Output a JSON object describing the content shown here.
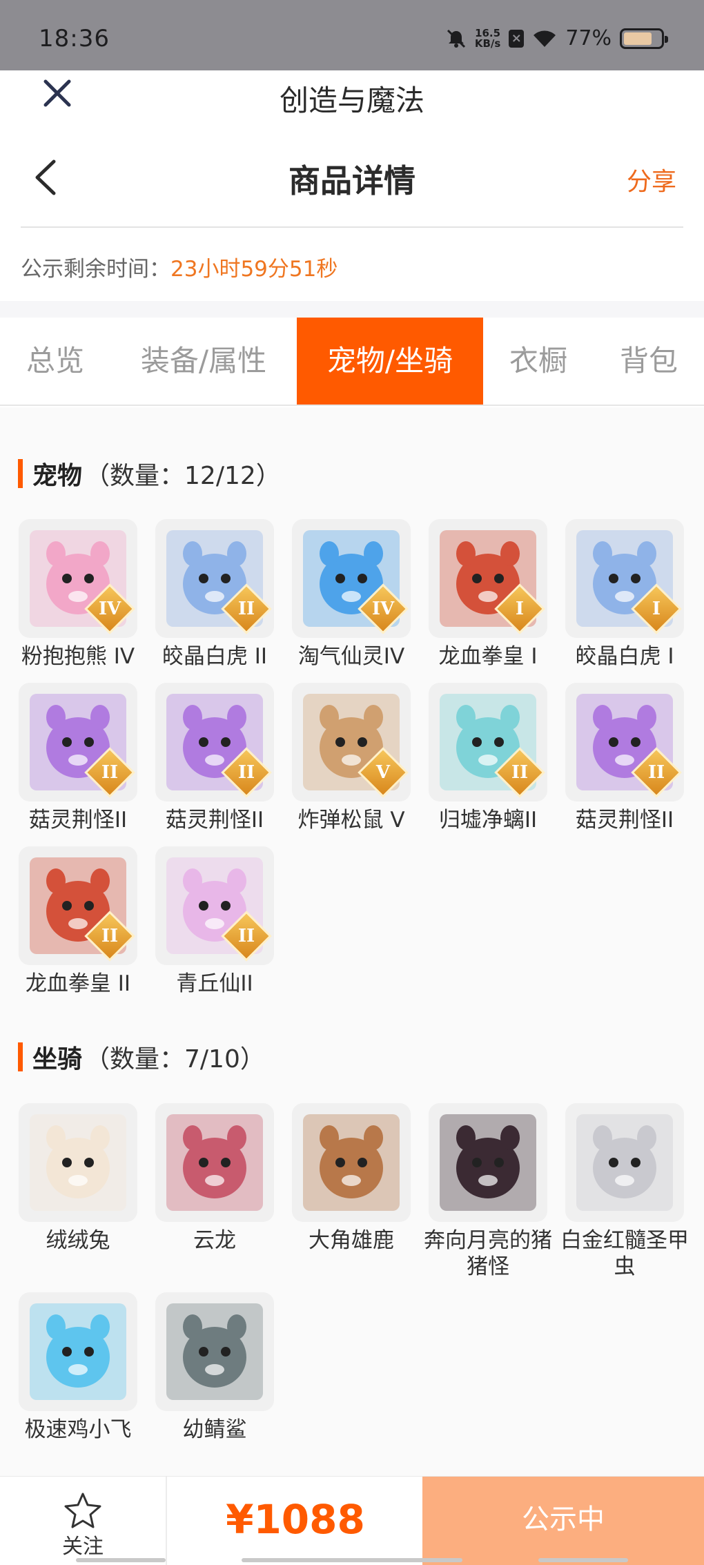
{
  "status_bar": {
    "time": "18:36",
    "speed_top": "16.5",
    "speed_bottom": "KB/s",
    "battery": "77%"
  },
  "app_title": "创造与魔法",
  "nav": {
    "title": "商品详情",
    "share": "分享"
  },
  "countdown": {
    "label": "公示剩余时间：",
    "value": "23小时59分51秒"
  },
  "tabs": [
    {
      "label": "总览"
    },
    {
      "label": "装备/属性"
    },
    {
      "label": "宠物/坐骑",
      "active": true
    },
    {
      "label": "衣橱"
    },
    {
      "label": "背包"
    }
  ],
  "pets": {
    "title": "宠物",
    "count": "（数量：12/12）",
    "items": [
      {
        "name": "粉抱抱熊 IV",
        "rank": "IV",
        "icon": "pink-bear-icon",
        "color": "#f2a7c8"
      },
      {
        "name": "皎晶白虎 II",
        "rank": "II",
        "icon": "white-tiger-icon",
        "color": "#8fb3e8"
      },
      {
        "name": "淘气仙灵IV",
        "rank": "IV",
        "icon": "blue-puppy-icon",
        "color": "#4ea3ea"
      },
      {
        "name": "龙血拳皇 I",
        "rank": "I",
        "icon": "dragon-boxer-icon",
        "color": "#d4513a"
      },
      {
        "name": "皎晶白虎 I",
        "rank": "I",
        "icon": "white-tiger-icon",
        "color": "#8fb3e8"
      },
      {
        "name": "菇灵荆怪II",
        "rank": "II",
        "icon": "mushroom-elf-icon",
        "color": "#b07be0"
      },
      {
        "name": "菇灵荆怪II",
        "rank": "II",
        "icon": "mushroom-elf-icon",
        "color": "#b07be0"
      },
      {
        "name": "炸弹松鼠 V",
        "rank": "V",
        "icon": "bomb-squirrel-icon",
        "color": "#d0a070"
      },
      {
        "name": "归墟净螭II",
        "rank": "II",
        "icon": "water-dragon-icon",
        "color": "#7fd3d8"
      },
      {
        "name": "菇灵荆怪II",
        "rank": "II",
        "icon": "mushroom-elf-icon",
        "color": "#b07be0"
      },
      {
        "name": "龙血拳皇 II",
        "rank": "II",
        "icon": "dragon-boxer-icon",
        "color": "#d4513a"
      },
      {
        "name": "青丘仙II",
        "rank": "II",
        "icon": "fox-fairy-icon",
        "color": "#e8b7e8"
      }
    ]
  },
  "mounts": {
    "title": "坐骑",
    "count": "（数量：7/10）",
    "items": [
      {
        "name": "绒绒兔",
        "icon": "fluffy-rabbit-icon",
        "color": "#f3e6d6"
      },
      {
        "name": "云龙",
        "icon": "cloud-dragon-icon",
        "color": "#c85b6e"
      },
      {
        "name": "大角雄鹿",
        "icon": "stag-icon",
        "color": "#b8784a"
      },
      {
        "name": "奔向月亮的猪猪怪",
        "icon": "moon-pig-icon",
        "color": "#3b2a33"
      },
      {
        "name": "白金红髓圣甲虫",
        "icon": "scarab-icon",
        "color": "#c9c9cf"
      },
      {
        "name": "极速鸡小飞",
        "icon": "blue-chick-icon",
        "color": "#5ec5ee"
      },
      {
        "name": "幼鲭鲨",
        "icon": "young-shark-icon",
        "color": "#6e7c7f"
      }
    ]
  },
  "bottom": {
    "follow": "关注",
    "price": "¥1088",
    "status": "公示中"
  },
  "colors": {
    "accent": "#ff5a00",
    "countdown": "#ef7621",
    "status_button": "#fcae7f"
  }
}
